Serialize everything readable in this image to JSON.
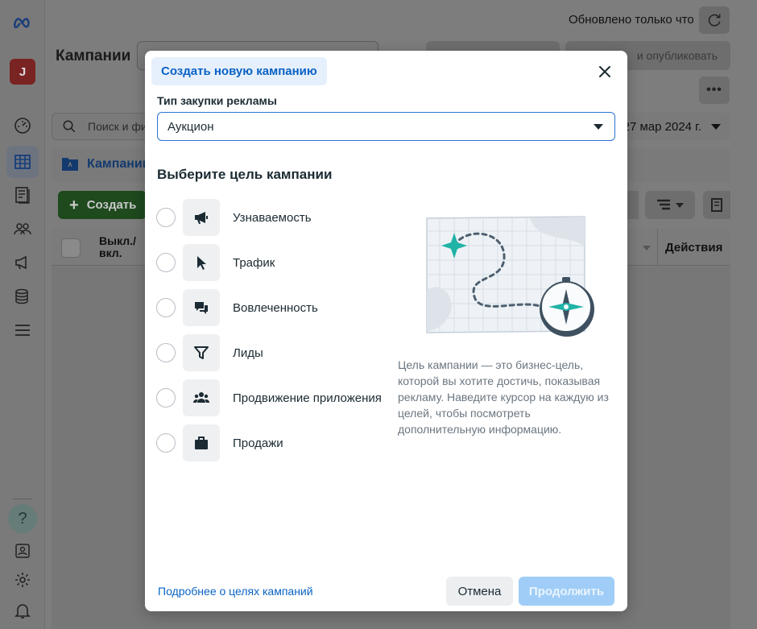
{
  "background": {
    "page_title": "Кампании",
    "updated_status": "Обновлено только что",
    "publish_button_label": "и опубликовать",
    "search_placeholder": "Поиск и фи",
    "date_range": "27 мар 2024 г.",
    "campaigns_tab_label": "Кампании",
    "create_button_label": "Создать",
    "table_headers": [
      "Выкл./ вкл.",
      "Действия"
    ],
    "avatar_initial": "J",
    "help_glyph": "?"
  },
  "modal": {
    "tab_label": "Создать новую кампанию",
    "buying_type_label": "Тип закупки рекламы",
    "buying_type_value": "Аукцион",
    "goal_heading": "Выберите цель кампании",
    "goals": [
      {
        "label": "Узнаваемость",
        "icon": "megaphone-icon"
      },
      {
        "label": "Трафик",
        "icon": "cursor-icon"
      },
      {
        "label": "Вовлеченность",
        "icon": "chat-bubbles-icon"
      },
      {
        "label": "Лиды",
        "icon": "funnel-icon"
      },
      {
        "label": "Продвижение приложения",
        "icon": "people-icon"
      },
      {
        "label": "Продажи",
        "icon": "shopping-bag-icon"
      }
    ],
    "description": "Цель кампании — это бизнес-цель, которой вы хотите достичь, показывая рекламу. Наведите курсор на каждую из целей, чтобы посмотреть дополнительную информацию.",
    "learn_more_link": "Подробнее о целях кампаний",
    "cancel_label": "Отмена",
    "continue_label": "Продолжить"
  },
  "colors": {
    "accent_blue": "#0a62c4",
    "tab_bg": "#e6f0fc",
    "continue_disabled": "#9fcdf7",
    "illustration_teal": "#20b3a6"
  }
}
